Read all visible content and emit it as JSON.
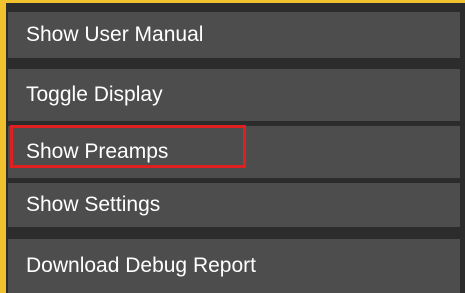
{
  "menu": {
    "accent_color": "#f2c12e",
    "items": [
      {
        "label": "Show User Manual"
      },
      {
        "label": "Toggle Display"
      },
      {
        "label": "Show Preamps",
        "highlighted": true,
        "highlight_color": "#e02020"
      },
      {
        "label": "Show Settings"
      },
      {
        "label": "Download Debug Report"
      }
    ]
  }
}
